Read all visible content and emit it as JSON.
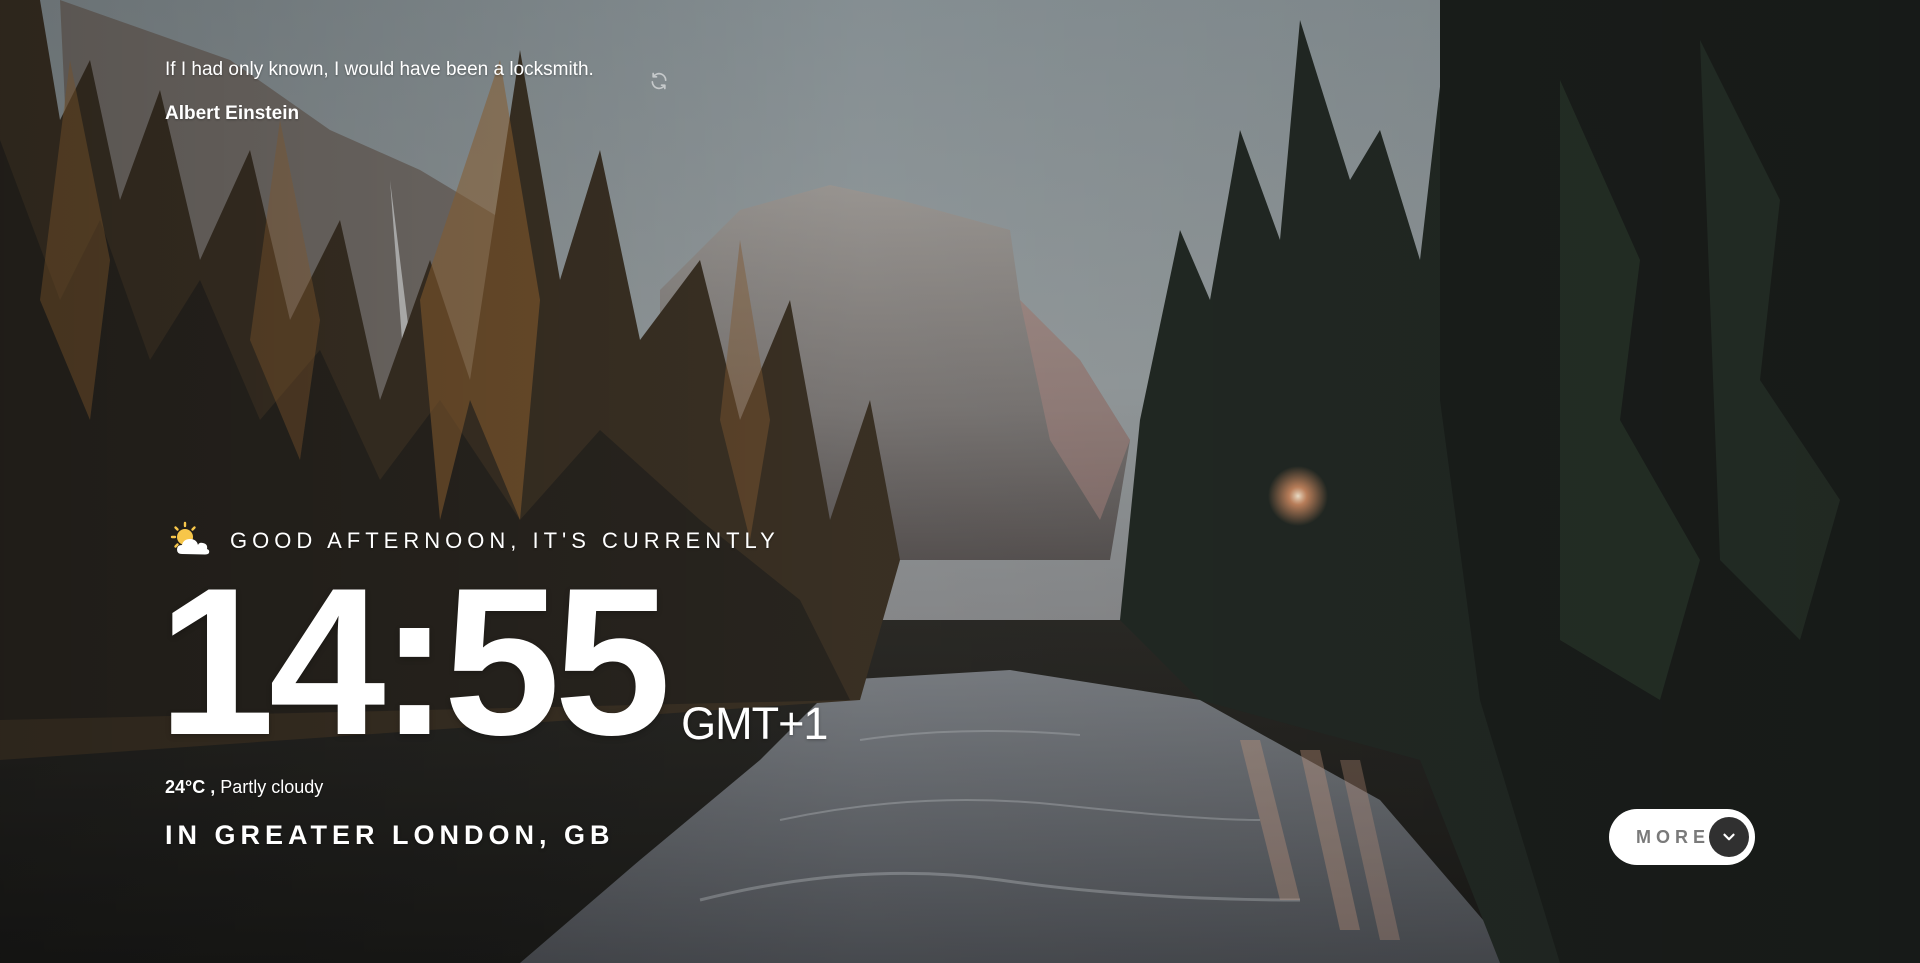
{
  "quote": {
    "text": "If I had only known, I would have been a locksmith.",
    "author": "Albert Einstein",
    "refresh_icon": "refresh-icon"
  },
  "clock": {
    "greeting": "GOOD AFTERNOON, IT'S CURRENTLY",
    "time": "14:55",
    "timezone": "GMT+1",
    "weather_icon": "partly-cloudy-sun-icon"
  },
  "weather": {
    "temperature": "24°C ,",
    "condition": "Partly cloudy"
  },
  "location": "IN GREATER LONDON, GB",
  "more_button": {
    "label": "MORE",
    "icon": "chevron-down-icon"
  },
  "colors": {
    "text": "#ffffff",
    "button_bg": "#ffffff",
    "button_text": "#7a7a7a",
    "chevron_bg": "#303030"
  }
}
